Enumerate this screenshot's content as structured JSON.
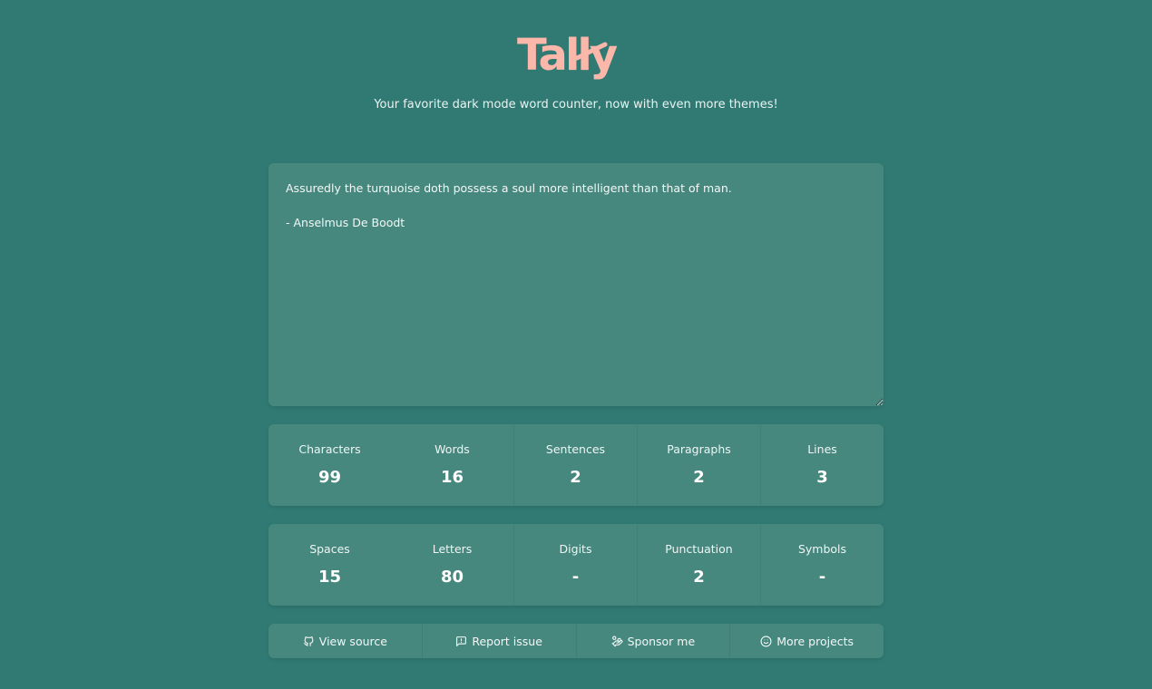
{
  "header": {
    "logo": "Tally",
    "tagline": "Your favorite dark mode word counter, now with even more themes!"
  },
  "editor": {
    "text": "Assuredly the turquoise doth possess a soul more intelligent than that of man.\n\n- Anselmus De Boodt"
  },
  "stats_row1": [
    {
      "label": "Characters",
      "value": "99"
    },
    {
      "label": "Words",
      "value": "16"
    },
    {
      "label": "Sentences",
      "value": "2"
    },
    {
      "label": "Paragraphs",
      "value": "2"
    },
    {
      "label": "Lines",
      "value": "3"
    }
  ],
  "stats_row2": [
    {
      "label": "Spaces",
      "value": "15"
    },
    {
      "label": "Letters",
      "value": "80"
    },
    {
      "label": "Digits",
      "value": "-"
    },
    {
      "label": "Punctuation",
      "value": "2"
    },
    {
      "label": "Symbols",
      "value": "-"
    }
  ],
  "footer": {
    "links": [
      {
        "label": "View source",
        "icon": "github-icon"
      },
      {
        "label": "Report issue",
        "icon": "message-alert-icon"
      },
      {
        "label": "Sponsor me",
        "icon": "hand-coins-icon"
      },
      {
        "label": "More projects",
        "icon": "smile-icon"
      }
    ]
  },
  "colors": {
    "background": "#317a74",
    "panel": "#46887e",
    "logo": "#fbb7aa",
    "text": "#ffffff"
  }
}
